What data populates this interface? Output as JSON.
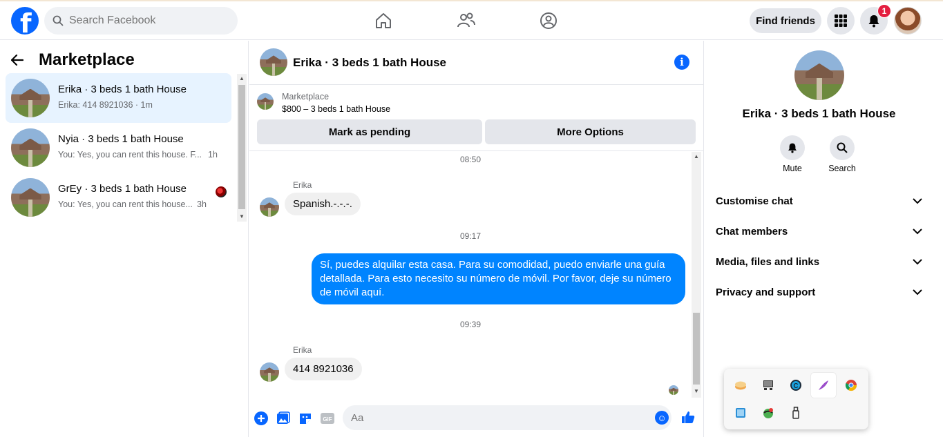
{
  "topbar": {
    "search_placeholder": "Search Facebook",
    "find_friends": "Find friends",
    "notification_count": "1"
  },
  "sidebar": {
    "title": "Marketplace",
    "conversations": [
      {
        "name": "Erika · 3 beds 1 bath House",
        "preview": "Erika: 414 8921036 · 1m",
        "time": ""
      },
      {
        "name": "Nyia · 3 beds 1 bath House",
        "preview": "You: Yes, you can rent this house. F...",
        "time": "1h"
      },
      {
        "name": "GrEy · 3 beds 1 bath House",
        "preview": "You: Yes, you can rent this house...",
        "time": "3h"
      }
    ]
  },
  "chat": {
    "title": "Erika · 3 beds 1 bath House",
    "listing_label": "Marketplace",
    "listing_price": "$800 – 3 beds 1 bath House",
    "mark_pending": "Mark as pending",
    "more_options": "More Options",
    "messages": [
      {
        "timestamp": "08:50"
      },
      {
        "sender": "Erika",
        "text": "Spanish.-.-.-."
      },
      {
        "timestamp": "09:17"
      },
      {
        "outgoing": true,
        "text": "Sí, puedes alquilar esta casa. Para su comodidad, puedo enviarle una guía detallada. Para esto necesito su número de móvil. Por favor, deje su número de móvil aquí."
      },
      {
        "timestamp": "09:39"
      },
      {
        "sender": "Erika",
        "text": "414 8921036"
      }
    ],
    "composer_placeholder": "Aa",
    "gif_label": "GIF"
  },
  "right_panel": {
    "title": "Erika · 3 beds 1 bath House",
    "actions": [
      {
        "label": "Mute"
      },
      {
        "label": "Search"
      }
    ],
    "sections": [
      "Customise chat",
      "Chat members",
      "Media, files and links",
      "Privacy and support"
    ]
  },
  "colors": {
    "brand": "#0866ff",
    "outgoing_bubble": "#0084ff",
    "active_conversation": "#e7f3ff",
    "badge": "#e41e3f"
  }
}
